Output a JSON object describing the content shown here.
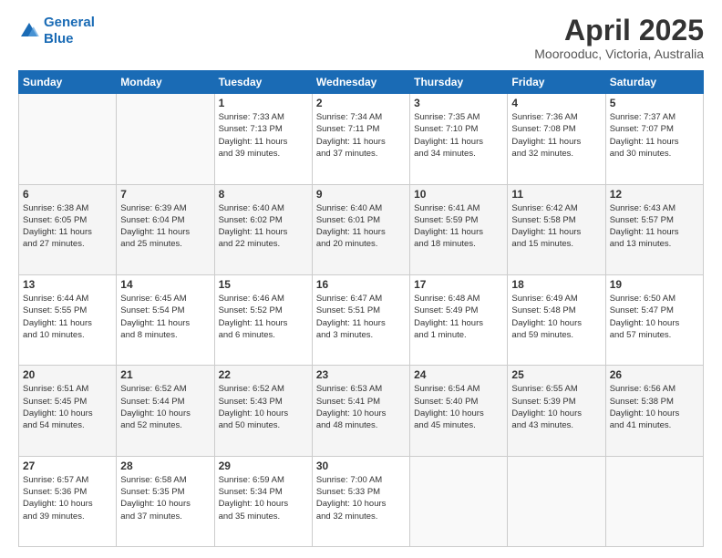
{
  "header": {
    "logo_line1": "General",
    "logo_line2": "Blue",
    "title": "April 2025",
    "subtitle": "Moorooduc, Victoria, Australia"
  },
  "days_of_week": [
    "Sunday",
    "Monday",
    "Tuesday",
    "Wednesday",
    "Thursday",
    "Friday",
    "Saturday"
  ],
  "weeks": [
    [
      {
        "day": "",
        "detail": ""
      },
      {
        "day": "",
        "detail": ""
      },
      {
        "day": "1",
        "detail": "Sunrise: 7:33 AM\nSunset: 7:13 PM\nDaylight: 11 hours\nand 39 minutes."
      },
      {
        "day": "2",
        "detail": "Sunrise: 7:34 AM\nSunset: 7:11 PM\nDaylight: 11 hours\nand 37 minutes."
      },
      {
        "day": "3",
        "detail": "Sunrise: 7:35 AM\nSunset: 7:10 PM\nDaylight: 11 hours\nand 34 minutes."
      },
      {
        "day": "4",
        "detail": "Sunrise: 7:36 AM\nSunset: 7:08 PM\nDaylight: 11 hours\nand 32 minutes."
      },
      {
        "day": "5",
        "detail": "Sunrise: 7:37 AM\nSunset: 7:07 PM\nDaylight: 11 hours\nand 30 minutes."
      }
    ],
    [
      {
        "day": "6",
        "detail": "Sunrise: 6:38 AM\nSunset: 6:05 PM\nDaylight: 11 hours\nand 27 minutes."
      },
      {
        "day": "7",
        "detail": "Sunrise: 6:39 AM\nSunset: 6:04 PM\nDaylight: 11 hours\nand 25 minutes."
      },
      {
        "day": "8",
        "detail": "Sunrise: 6:40 AM\nSunset: 6:02 PM\nDaylight: 11 hours\nand 22 minutes."
      },
      {
        "day": "9",
        "detail": "Sunrise: 6:40 AM\nSunset: 6:01 PM\nDaylight: 11 hours\nand 20 minutes."
      },
      {
        "day": "10",
        "detail": "Sunrise: 6:41 AM\nSunset: 5:59 PM\nDaylight: 11 hours\nand 18 minutes."
      },
      {
        "day": "11",
        "detail": "Sunrise: 6:42 AM\nSunset: 5:58 PM\nDaylight: 11 hours\nand 15 minutes."
      },
      {
        "day": "12",
        "detail": "Sunrise: 6:43 AM\nSunset: 5:57 PM\nDaylight: 11 hours\nand 13 minutes."
      }
    ],
    [
      {
        "day": "13",
        "detail": "Sunrise: 6:44 AM\nSunset: 5:55 PM\nDaylight: 11 hours\nand 10 minutes."
      },
      {
        "day": "14",
        "detail": "Sunrise: 6:45 AM\nSunset: 5:54 PM\nDaylight: 11 hours\nand 8 minutes."
      },
      {
        "day": "15",
        "detail": "Sunrise: 6:46 AM\nSunset: 5:52 PM\nDaylight: 11 hours\nand 6 minutes."
      },
      {
        "day": "16",
        "detail": "Sunrise: 6:47 AM\nSunset: 5:51 PM\nDaylight: 11 hours\nand 3 minutes."
      },
      {
        "day": "17",
        "detail": "Sunrise: 6:48 AM\nSunset: 5:49 PM\nDaylight: 11 hours\nand 1 minute."
      },
      {
        "day": "18",
        "detail": "Sunrise: 6:49 AM\nSunset: 5:48 PM\nDaylight: 10 hours\nand 59 minutes."
      },
      {
        "day": "19",
        "detail": "Sunrise: 6:50 AM\nSunset: 5:47 PM\nDaylight: 10 hours\nand 57 minutes."
      }
    ],
    [
      {
        "day": "20",
        "detail": "Sunrise: 6:51 AM\nSunset: 5:45 PM\nDaylight: 10 hours\nand 54 minutes."
      },
      {
        "day": "21",
        "detail": "Sunrise: 6:52 AM\nSunset: 5:44 PM\nDaylight: 10 hours\nand 52 minutes."
      },
      {
        "day": "22",
        "detail": "Sunrise: 6:52 AM\nSunset: 5:43 PM\nDaylight: 10 hours\nand 50 minutes."
      },
      {
        "day": "23",
        "detail": "Sunrise: 6:53 AM\nSunset: 5:41 PM\nDaylight: 10 hours\nand 48 minutes."
      },
      {
        "day": "24",
        "detail": "Sunrise: 6:54 AM\nSunset: 5:40 PM\nDaylight: 10 hours\nand 45 minutes."
      },
      {
        "day": "25",
        "detail": "Sunrise: 6:55 AM\nSunset: 5:39 PM\nDaylight: 10 hours\nand 43 minutes."
      },
      {
        "day": "26",
        "detail": "Sunrise: 6:56 AM\nSunset: 5:38 PM\nDaylight: 10 hours\nand 41 minutes."
      }
    ],
    [
      {
        "day": "27",
        "detail": "Sunrise: 6:57 AM\nSunset: 5:36 PM\nDaylight: 10 hours\nand 39 minutes."
      },
      {
        "day": "28",
        "detail": "Sunrise: 6:58 AM\nSunset: 5:35 PM\nDaylight: 10 hours\nand 37 minutes."
      },
      {
        "day": "29",
        "detail": "Sunrise: 6:59 AM\nSunset: 5:34 PM\nDaylight: 10 hours\nand 35 minutes."
      },
      {
        "day": "30",
        "detail": "Sunrise: 7:00 AM\nSunset: 5:33 PM\nDaylight: 10 hours\nand 32 minutes."
      },
      {
        "day": "",
        "detail": ""
      },
      {
        "day": "",
        "detail": ""
      },
      {
        "day": "",
        "detail": ""
      }
    ]
  ]
}
